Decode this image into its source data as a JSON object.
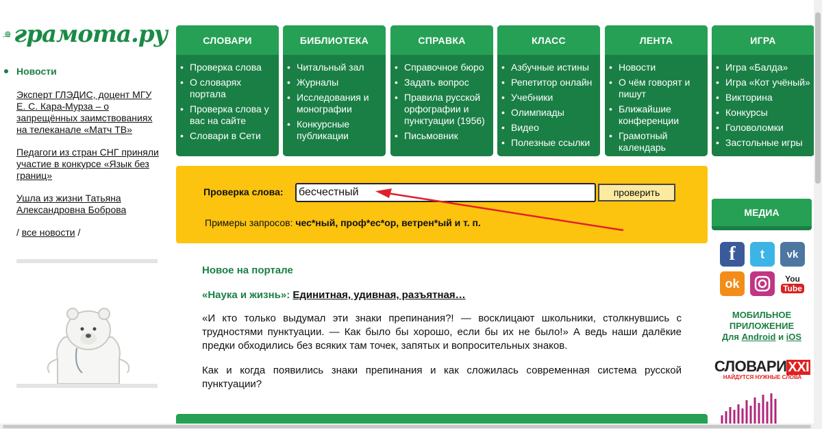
{
  "logo": {
    "text": "грамота.ру"
  },
  "left": {
    "news_heading": "Новости",
    "news": [
      "Эксперт ГЛЭДИС, доцент МГУ Е. С. Кара-Мурза – о запрещённых заимствованиях на телеканале «Матч ТВ»",
      "Педагоги из стран СНГ приняли участие в конкурсе «Язык без границ»",
      "Ушла из жизни Татьяна Александровна Боброва"
    ],
    "all_news_pre": "/ ",
    "all_news": "все новости",
    "all_news_post": " /"
  },
  "nav": [
    {
      "title": "СЛОВАРИ",
      "items": [
        "Проверка слова",
        "О словарях портала",
        "Проверка слова у вас на сайте",
        "Словари в Сети"
      ]
    },
    {
      "title": "БИБЛИОТЕКА",
      "items": [
        "Читальный зал",
        "Журналы",
        "Исследования и монографии",
        "Конкурсные публикации"
      ]
    },
    {
      "title": "СПРАВКА",
      "items": [
        "Справочное бюро",
        "Задать вопрос",
        "Правила русской орфографии и пунктуации (1956)",
        "Письмовник"
      ]
    },
    {
      "title": "КЛАСС",
      "items": [
        "Азбучные истины",
        "Репетитор онлайн",
        "Учебники",
        "Олимпиады",
        "Видео",
        "Полезные ссылки"
      ]
    },
    {
      "title": "ЛЕНТА",
      "items": [
        "Новости",
        "О чём говорят и пишут",
        "Ближайшие конференции",
        "Грамотный календарь"
      ]
    },
    {
      "title": "ИГРА",
      "items": [
        "Игра «Балда»",
        "Игра «Кот учёный»",
        "Викторина",
        "Конкурсы",
        "Головоломки",
        "Застольные игры"
      ]
    }
  ],
  "search": {
    "label": "Проверка слова:",
    "value": "бесчестный",
    "button": "проверить",
    "examples_label": "Примеры запросов: ",
    "examples": "чес*ный, проф*ес*ор, ветрен*ый и т. п."
  },
  "content": {
    "title": "Новое на портале",
    "source": "«Наука и жизнь»:",
    "article_link": "Единитная, удивная, разъятная…",
    "para1": "«И кто только выдумал эти знаки препинания?! — восклицают школьники, столкнувшись с трудностями пунктуации. — Как было бы хорошо, если бы их не было!» А ведь наши далёкие предки обходились без всяких там точек, запятых и вопросительных знаков.",
    "para2": "Как и когда появились знаки препинания и как сложилась современная система русской пунктуации?"
  },
  "right": {
    "media_title": "МЕДИА",
    "social": [
      "facebook-icon",
      "twitter-icon",
      "vk-icon",
      "odnoklassniki-icon",
      "instagram-icon",
      "youtube-icon"
    ],
    "mobile_line1": "МОБИЛЬНОЕ",
    "mobile_line2": "ПРИЛОЖЕНИЕ",
    "mobile_for": "Для ",
    "android": "Android",
    "and": " и ",
    "ios": "iOS",
    "slovari_main": "СЛОВАРИ",
    "slovari_xxi": "XXI",
    "slovari_sub": "НАЙДУТСЯ НУЖНЫЕ СЛОВА"
  },
  "colors": {
    "green": "#1a7f45",
    "green_light": "#26a055",
    "yellow": "#fcc30f",
    "arrow": "#e0202a"
  }
}
